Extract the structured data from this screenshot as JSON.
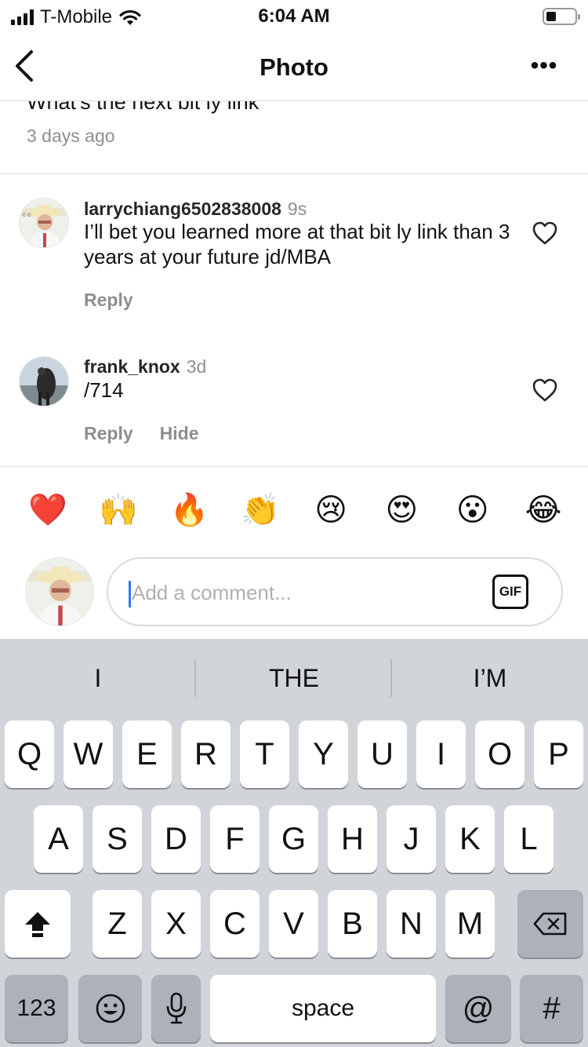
{
  "status_bar": {
    "carrier": "T-Mobile",
    "time": "6:04 AM"
  },
  "nav": {
    "title": "Photo",
    "more": "•••"
  },
  "previous_comment": {
    "text": "What's the next bit ly link",
    "time": "3 days ago"
  },
  "comments": [
    {
      "username": "larrychiang6502838008",
      "age": "9s",
      "text": "I’ll bet you learned more at that bit ly link than 3 years at your future jd/MBA",
      "actions": [
        "Reply"
      ]
    },
    {
      "username": "frank_knox",
      "age": "3d",
      "text": "/714",
      "actions": [
        "Reply",
        "Hide"
      ]
    }
  ],
  "emoji_bar": [
    "❤️",
    "🙌",
    "🔥",
    "👏",
    "😢",
    "😍",
    "😮",
    "😂"
  ],
  "composer": {
    "placeholder": "Add a comment...",
    "gif_label": "GIF"
  },
  "keyboard": {
    "suggestions": [
      "I",
      "THE",
      "I’M"
    ],
    "row1": [
      "Q",
      "W",
      "E",
      "R",
      "T",
      "Y",
      "U",
      "I",
      "O",
      "P"
    ],
    "row2": [
      "A",
      "S",
      "D",
      "F",
      "G",
      "H",
      "J",
      "K",
      "L"
    ],
    "row3": [
      "Z",
      "X",
      "C",
      "V",
      "B",
      "N",
      "M"
    ],
    "numbers_label": "123",
    "space_label": "space",
    "at_label": "@",
    "hash_label": "#"
  }
}
